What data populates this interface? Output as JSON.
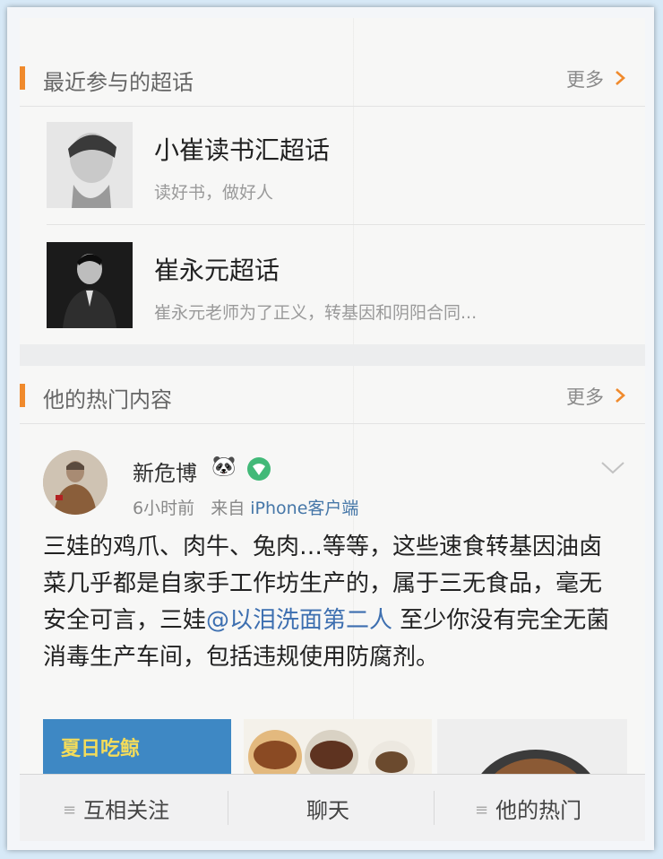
{
  "section_topics": {
    "title": "最近参与的超话",
    "more": "更多",
    "items": [
      {
        "name": "小崔读书汇超话",
        "desc": "读好书，做好人"
      },
      {
        "name": "崔永元超话",
        "desc": "崔永元老师为了正义，转基因和阴阳合同..."
      }
    ]
  },
  "section_hot": {
    "title": "他的热门内容",
    "more": "更多"
  },
  "post": {
    "author": "新危博",
    "badge_panda": "🐼",
    "time": "6小时前",
    "from_prefix": "来自",
    "source": "iPhone客户端",
    "text_before": "三娃的鸡爪、肉牛、兔肉…等等，这些速食转基因油卤菜几乎都是自家手工作坊生产的，属于三无食品，毫无安全可言，三娃",
    "mention": "@以泪洗面第二人",
    "text_after": " 至少你没有完全无菌消毒生产车间，包括违规使用防腐剂。",
    "image1_caption": "夏日吃鲸"
  },
  "bottom_bar": {
    "follow": "互相关注",
    "chat": "聊天",
    "hot": "他的热门"
  },
  "colors": {
    "accent": "#f08a2c",
    "link": "#3d6fb0",
    "vip_badge": "#42b978"
  }
}
